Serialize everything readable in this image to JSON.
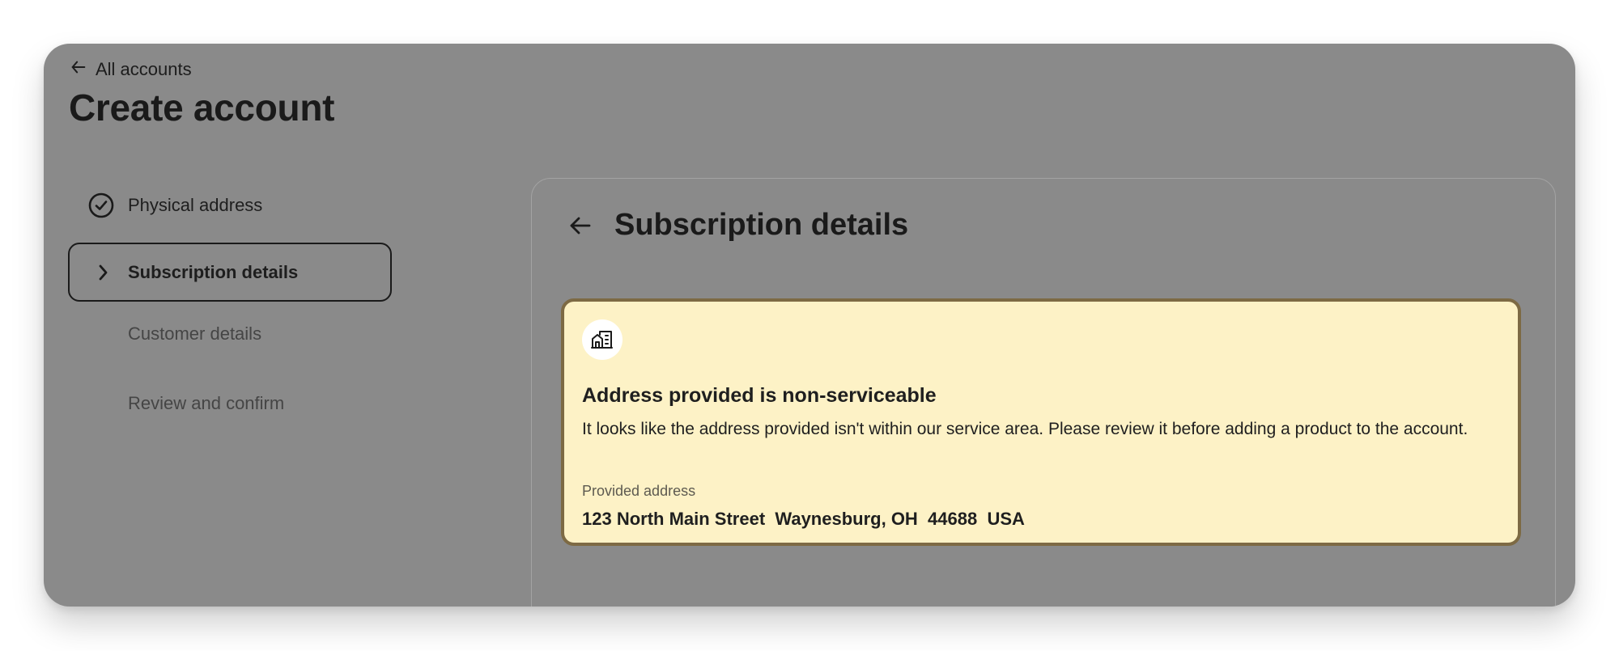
{
  "nav": {
    "back_label": "All accounts"
  },
  "page": {
    "title": "Create account"
  },
  "steps": [
    {
      "label": "Physical address",
      "state": "completed",
      "icon": "check-circle-icon"
    },
    {
      "label": "Subscription details",
      "state": "current",
      "icon": "chevron-right-icon"
    },
    {
      "label": "Customer details",
      "state": "pending"
    },
    {
      "label": "Review and confirm",
      "state": "pending"
    }
  ],
  "panel": {
    "title": "Subscription details",
    "back_icon": "arrow-left-icon"
  },
  "alert": {
    "icon": "building-icon",
    "title": "Address provided is non-serviceable",
    "message": "It looks like the address provided isn't within our service area. Please review it before adding a product to the account.",
    "address_label": "Provided address",
    "address_value": "123 North Main Street  Waynesburg, OH  44688  USA"
  },
  "colors": {
    "overlay": "#8a8a8a",
    "alert_background": "#fdf2c6",
    "alert_border": "#7d6a44"
  }
}
